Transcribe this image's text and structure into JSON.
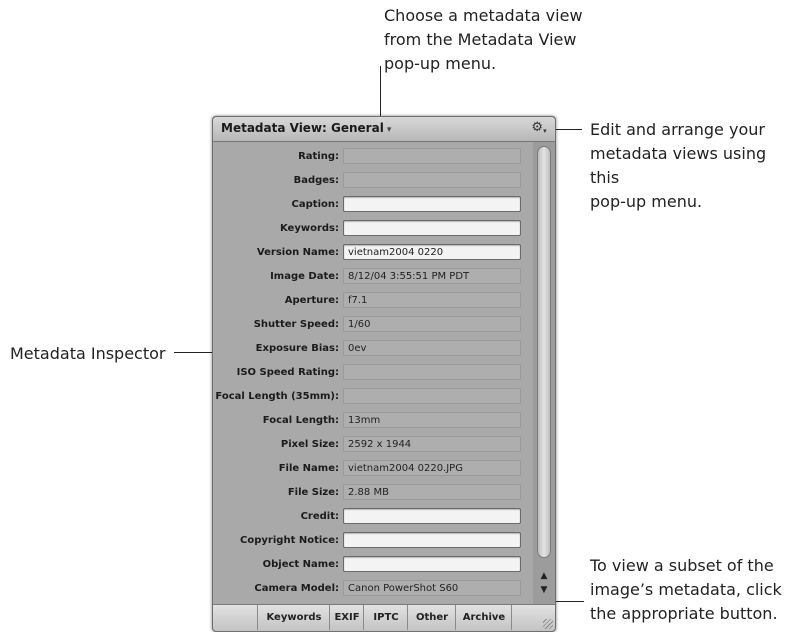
{
  "callouts": {
    "top": "Choose a metadata view\nfrom the Metadata View\npop-up menu.",
    "right": "Edit and arrange your\nmetadata views using this\npop-up menu.",
    "left": "Metadata Inspector",
    "bottom": "To view a subset of the\nimage’s metadata, click\nthe appropriate button."
  },
  "panel": {
    "view_menu_label": "Metadata View: General",
    "view_menu_chevron": "▾",
    "action_menu_icon": "gear-icon",
    "fields": [
      {
        "label": "Rating:",
        "value": "",
        "editable": false
      },
      {
        "label": "Badges:",
        "value": "",
        "editable": false
      },
      {
        "label": "Caption:",
        "value": "",
        "editable": true
      },
      {
        "label": "Keywords:",
        "value": "",
        "editable": true
      },
      {
        "label": "Version Name:",
        "value": "vietnam2004 0220",
        "editable": true
      },
      {
        "label": "Image Date:",
        "value": "8/12/04 3:55:51 PM PDT",
        "editable": false
      },
      {
        "label": "Aperture:",
        "value": "f7.1",
        "editable": false
      },
      {
        "label": "Shutter Speed:",
        "value": "1/60",
        "editable": false
      },
      {
        "label": "Exposure Bias:",
        "value": "0ev",
        "editable": false
      },
      {
        "label": "ISO Speed Rating:",
        "value": "",
        "editable": false
      },
      {
        "label": "Focal Length (35mm):",
        "value": "",
        "editable": false
      },
      {
        "label": "Focal Length:",
        "value": "13mm",
        "editable": false
      },
      {
        "label": "Pixel Size:",
        "value": "2592 x 1944",
        "editable": false
      },
      {
        "label": "File Name:",
        "value": "vietnam2004 0220.JPG",
        "editable": false
      },
      {
        "label": "File Size:",
        "value": "2.88 MB",
        "editable": false
      },
      {
        "label": "Credit:",
        "value": "",
        "editable": true
      },
      {
        "label": "Copyright Notice:",
        "value": "",
        "editable": true
      },
      {
        "label": "Object Name:",
        "value": "",
        "editable": true
      },
      {
        "label": "Camera Model:",
        "value": "Canon PowerShot S60",
        "editable": false
      }
    ],
    "buttons": [
      "Keywords",
      "EXIF",
      "IPTC",
      "Other",
      "Archive"
    ]
  }
}
